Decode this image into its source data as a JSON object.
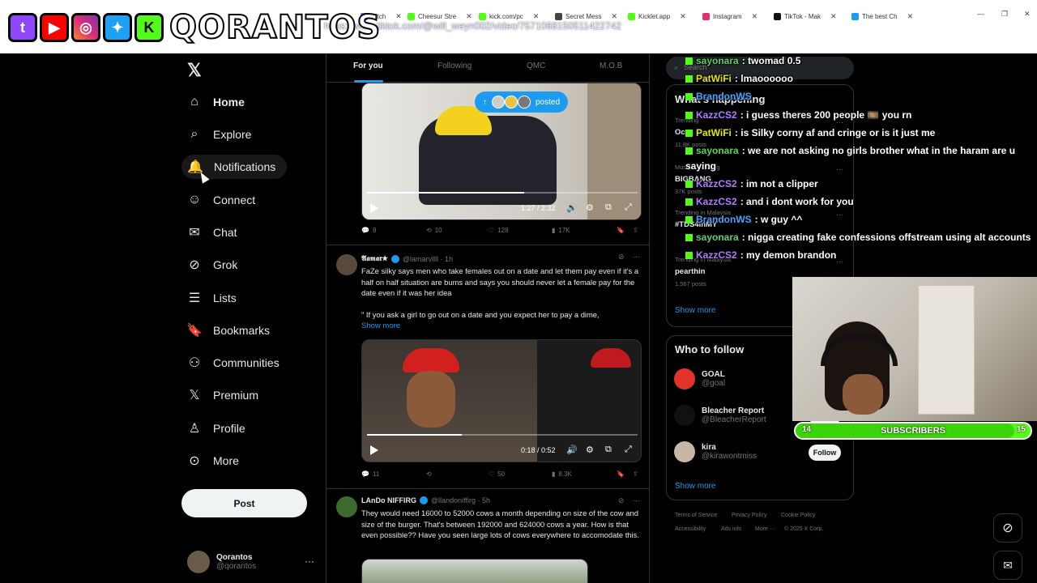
{
  "browser": {
    "tabs": [
      {
        "label": "witch",
        "color": "#9146ff"
      },
      {
        "label": "Cheesur Stre",
        "color": "#53fc18"
      },
      {
        "label": "kick.com/pc",
        "color": "#53fc18"
      },
      {
        "label": "Secret Mess",
        "color": "#444444"
      },
      {
        "label": "Kicklet.app",
        "color": "#53fc18"
      },
      {
        "label": "Instagram",
        "color": "#e1306c"
      },
      {
        "label": "TikTok - Mak",
        "color": "#111111"
      },
      {
        "label": "The best Ch",
        "color": "#1d9bf0"
      }
    ],
    "url": "https://www.tiktok.com/@will_weyn002/video/7571068150511422742"
  },
  "logo": {
    "text": "QORANTOS"
  },
  "nav": {
    "items": [
      {
        "label": "Home",
        "icon": "home-icon"
      },
      {
        "label": "Explore",
        "icon": "search-icon"
      },
      {
        "label": "Notifications",
        "icon": "bell-icon"
      },
      {
        "label": "Connect",
        "icon": "person-add-icon"
      },
      {
        "label": "Chat",
        "icon": "mail-icon"
      },
      {
        "label": "Grok",
        "icon": "grok-icon"
      },
      {
        "label": "Lists",
        "icon": "list-icon"
      },
      {
        "label": "Bookmarks",
        "icon": "bookmark-icon"
      },
      {
        "label": "Communities",
        "icon": "people-icon"
      },
      {
        "label": "Premium",
        "icon": "x-icon"
      },
      {
        "label": "Profile",
        "icon": "user-icon"
      },
      {
        "label": "More",
        "icon": "more-circle-icon"
      }
    ],
    "post_label": "Post",
    "profile_name": "Qorantos",
    "profile_handle": "@qorantos",
    "profile_more": "···"
  },
  "feed": {
    "tabs": [
      "For you",
      "Following",
      "QMC",
      "M.O.B"
    ],
    "post1": {
      "posted_label": "posted",
      "time": "1:27 / 2:32",
      "progress": 0.58,
      "replies": "8",
      "reposts": "10",
      "likes": "128",
      "views": "17K"
    },
    "post2": {
      "name": "𝕬𝖆𝖒𝖆𝖗★",
      "handle": "@lamarvllll · 1h",
      "text": "FaZe silky says men  who take females out on a date and let them  pay even if it's a half on half situation are bums and says you should never let a female pay for the date even if it was her idea",
      "quote": "\" If you ask a girl to go out on a date and you expect her to pay a dime,",
      "show_more": "Show more",
      "time": "0:18 / 0:52",
      "progress": 0.35,
      "replies": "11",
      "likes": "50",
      "views": "8.3K"
    },
    "post3": {
      "name": "LAnDo NIFFIRG",
      "handle": "@llandoniffirg · 5h",
      "text": "They would need 16000 to 52000 cows a month depending on size of the cow and size of the burger.   That's between 192000 and 624000 cows a year.  How is that even possible?? Have you seen large lots of cows everywhere to accomodate this."
    }
  },
  "right": {
    "search_placeholder": "Search",
    "happening_title": "What's happening",
    "trends": [
      {
        "meta": "Trending",
        "name": "Oc",
        "count": "11.8K posts"
      },
      {
        "meta": "Music · Trending",
        "name": "BIGBANG",
        "count": "37K posts"
      },
      {
        "meta": "Trending in Malaysia",
        "name": "#TDS4inMY",
        "count": ""
      },
      {
        "meta": "Trending in Malaysia",
        "name": "pearthin",
        "count": "1,567 posts"
      }
    ],
    "show_more": "Show more",
    "wtf_title": "Who to follow",
    "wtf": [
      {
        "name": "GOAL",
        "handle": "@goal",
        "color": "#e0342a"
      },
      {
        "name": "Bleacher Report",
        "handle": "@BleacherReport",
        "color": "#111111"
      },
      {
        "name": "kira",
        "handle": "@kirawontmiss",
        "color": "#c9b7a6"
      }
    ],
    "follow_label": "Follow",
    "wtf_show_more": "Show more",
    "footer": [
      "Terms of Service",
      "Privacy Policy",
      "Cookie Policy",
      "Accessibility",
      "Ads info",
      "More ···",
      "© 2025 X Corp."
    ]
  },
  "chat": [
    {
      "user": "sayonara",
      "color": "#5fd35f",
      "msg": ": twomad 0.5"
    },
    {
      "user": "PatWiFi",
      "color": "#e6e600",
      "msg": ": lmaoooooo"
    },
    {
      "user": "BrandonWS",
      "color": "#4aa3ff",
      "msg": ""
    },
    {
      "user": "KazzCS2",
      "color": "#b07cff",
      "msg": ": i guess theres 200 people 🎞️ you rn"
    },
    {
      "user": "PatWiFi",
      "color": "#e6e600",
      "msg": ": is Silky corny af and cringe or is it just me"
    },
    {
      "user": "sayonara",
      "color": "#5fd35f",
      "msg": ": we are not asking no girls brother what in the haram are u"
    },
    {
      "user": "",
      "color": "#ffffff",
      "msg": "saying"
    },
    {
      "user": "KazzCS2",
      "color": "#b07cff",
      "msg": ": im not a clipper"
    },
    {
      "user": "KazzCS2",
      "color": "#b07cff",
      "msg": ": and i dont work for you"
    },
    {
      "user": "BrandonWS",
      "color": "#4aa3ff",
      "msg": ": w guy ^^"
    },
    {
      "user": "sayonara",
      "color": "#5fd35f",
      "msg": ": nigga creating fake confessions offstream using alt accounts"
    },
    {
      "user": "KazzCS2",
      "color": "#b07cff",
      "msg": ": my demon brandon"
    }
  ],
  "subs": {
    "label": "SUBSCRIBERS",
    "current": "14",
    "goal": "15",
    "progress": 0.93
  }
}
